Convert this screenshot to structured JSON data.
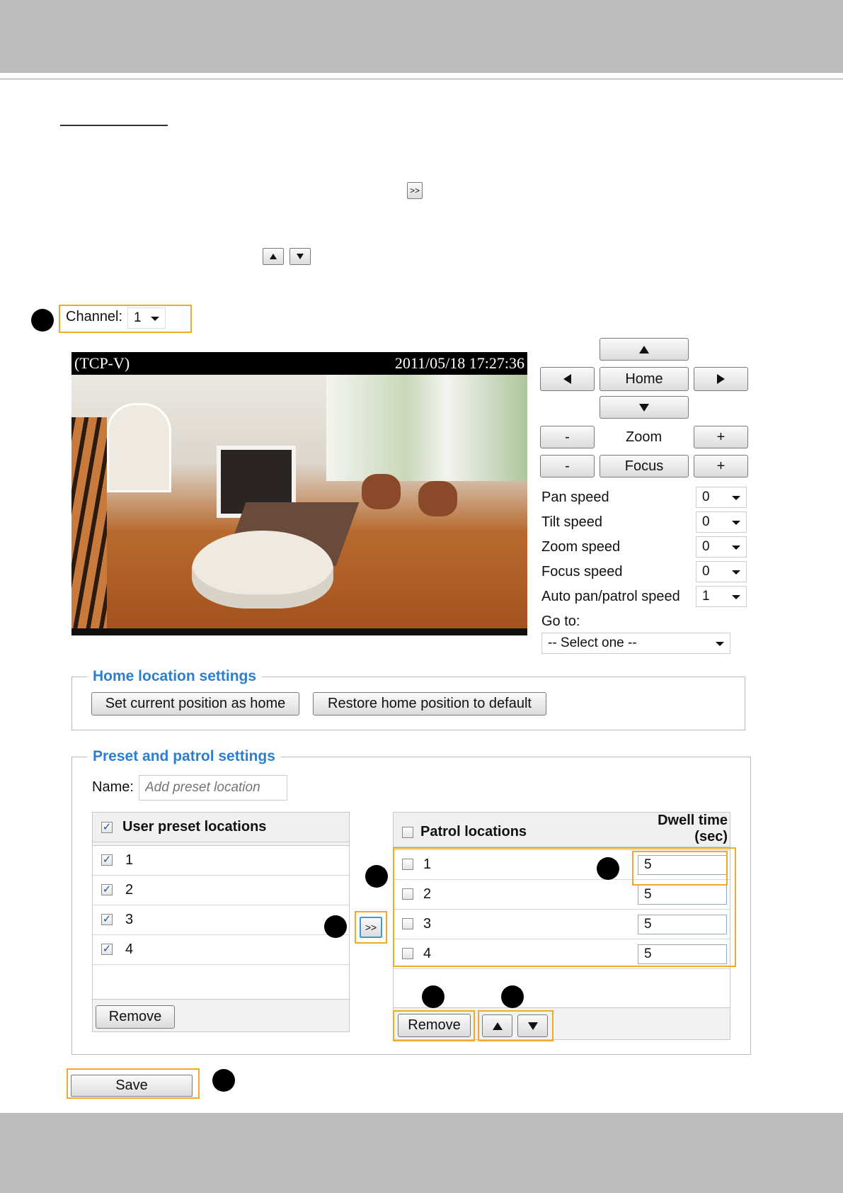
{
  "inline_icons": {
    "add_icon": ">>"
  },
  "channel": {
    "label": "Channel:",
    "value": "1"
  },
  "video": {
    "overlay_left": "(TCP-V)",
    "overlay_right": "2011/05/18 17:27:36"
  },
  "ptz": {
    "home_label": "Home",
    "zoom_label": "Zoom",
    "focus_label": "Focus",
    "minus_label": "-",
    "plus_label": "+",
    "speeds": [
      {
        "label": "Pan speed",
        "value": "0"
      },
      {
        "label": "Tilt speed",
        "value": "0"
      },
      {
        "label": "Zoom speed",
        "value": "0"
      },
      {
        "label": "Focus speed",
        "value": "0"
      },
      {
        "label": "Auto pan/patrol speed",
        "value": "1"
      }
    ],
    "goto_label": "Go to:",
    "goto_value": "-- Select one --"
  },
  "home_settings": {
    "title": "Home location settings",
    "set_button": "Set current position as home",
    "restore_button": "Restore home position to default"
  },
  "preset": {
    "title": "Preset and patrol settings",
    "name_label": "Name:",
    "name_placeholder": "Add preset location",
    "user_header": "User preset locations",
    "user_items": [
      "1",
      "2",
      "3",
      "4"
    ],
    "user_remove": "Remove",
    "add_button": ">>",
    "patrol_header": "Patrol locations",
    "dwell_header_line1": "Dwell time",
    "dwell_header_line2": "(sec)",
    "patrol_items": [
      {
        "name": "1",
        "dwell": "5"
      },
      {
        "name": "2",
        "dwell": "5"
      },
      {
        "name": "3",
        "dwell": "5"
      },
      {
        "name": "4",
        "dwell": "5"
      }
    ],
    "patrol_remove": "Remove"
  },
  "save_label": "Save",
  "colors": {
    "accent": "#2b7fcf",
    "highlight": "#f0a92a",
    "bar_gray": "#bdbdbd"
  }
}
